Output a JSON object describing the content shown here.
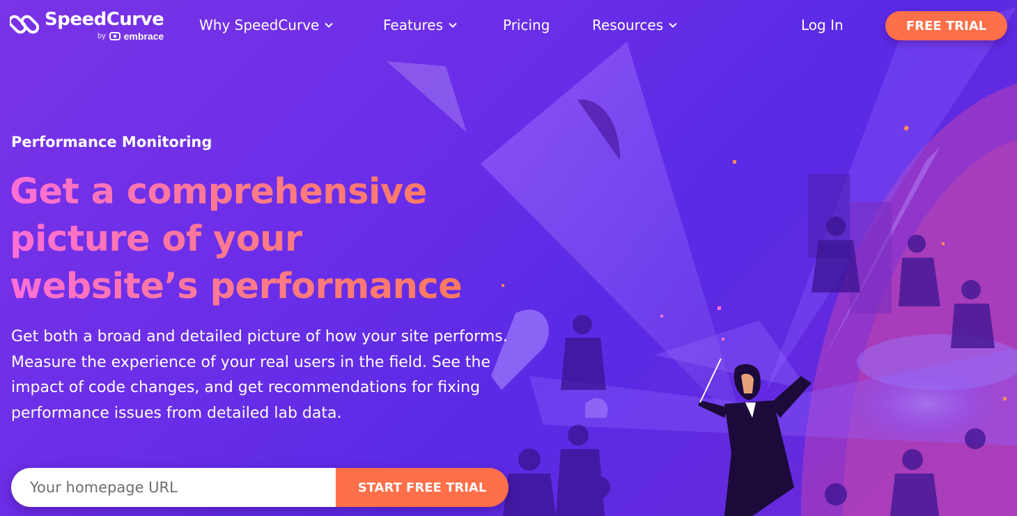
{
  "header": {
    "logo": {
      "name": "SpeedCurve",
      "by": "by",
      "partner": "embrace"
    },
    "nav": {
      "why": "Why SpeedCurve",
      "features": "Features",
      "pricing": "Pricing",
      "resources": "Resources",
      "login": "Log In"
    },
    "cta": "FREE TRIAL"
  },
  "hero": {
    "eyebrow": "Performance Monitoring",
    "headline": "Get a comprehensive picture of your website’s performance",
    "description": "Get both a broad and detailed picture of how your site performs. Measure the experience of your real users in the field. See the impact of code changes, and get recommendations for fixing performance issues from detailed lab data.",
    "form": {
      "placeholder": "Your homepage URL",
      "button": "START FREE TRIAL"
    }
  },
  "colors": {
    "accent": "#ff6f4a",
    "background": "#6a2be0",
    "headline_gradient_start": "#ff6fd8",
    "headline_gradient_end": "#ff7a5a"
  },
  "icons": [
    "speedcurve-logo-icon",
    "embrace-logo-icon",
    "chevron-down-icon"
  ]
}
